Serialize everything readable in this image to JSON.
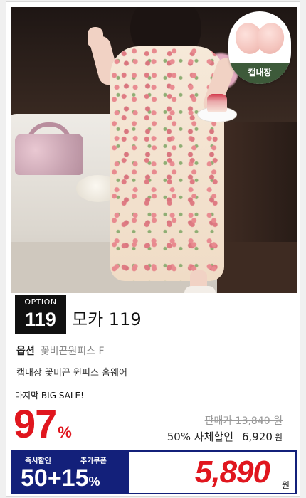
{
  "product": {
    "image_badge": "캡내장",
    "option_box": {
      "label": "OPTION",
      "number": "119"
    },
    "name": "모카 119",
    "option_key": "옵션",
    "option_value": "꽃비끈원피스 F",
    "description": "캡내장 꽃비끈 원피스 홈웨어"
  },
  "pricing": {
    "sale_headline": "마지막 BIG SALE!",
    "discount_number": "97",
    "discount_unit": "%",
    "original_price": "판매가 13,840 원",
    "self_discount_label": "50% 자체할인",
    "self_discount_price": "6,920",
    "self_discount_won": "원"
  },
  "coupon": {
    "instant_label": "즉시할인",
    "extra_label": "추가쿠폰",
    "value": "50+15",
    "unit": "%",
    "final_price": "5,890",
    "final_won": "원"
  },
  "colors": {
    "accent_red": "#e0161e",
    "navy": "#13207a",
    "badge_green": "#3d5a3a"
  }
}
